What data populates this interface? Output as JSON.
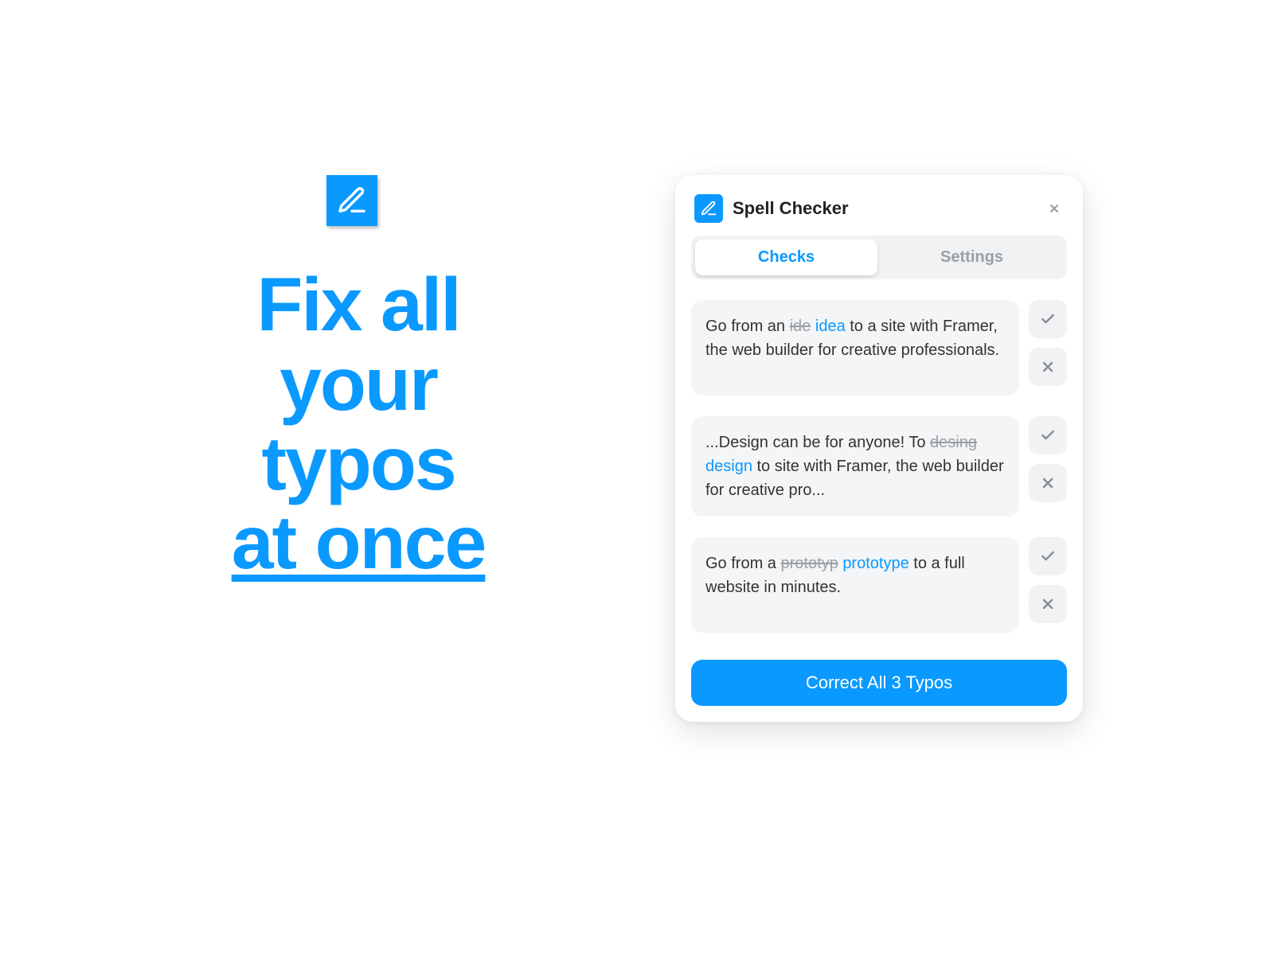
{
  "headline": {
    "line1": "Fix all",
    "line2": "your",
    "line3": "typos",
    "line4": "at once"
  },
  "panel": {
    "title": "Spell Checker",
    "tabs": {
      "checks": "Checks",
      "settings": "Settings"
    },
    "checks": [
      {
        "pre": "Go from an ",
        "strike": "ide",
        "fix": "idea",
        "post": " to a site with Framer, the web builder for creative professionals."
      },
      {
        "pre": "...Design can be for anyone! To ",
        "strike": "desing",
        "fix": "design",
        "post": " to site with Framer, the web builder for creative pro..."
      },
      {
        "pre": "Go from a ",
        "strike": "prototyp",
        "fix": "prototype",
        "post": " to a full website in minutes."
      }
    ],
    "correct_all": "Correct All 3 Typos"
  }
}
